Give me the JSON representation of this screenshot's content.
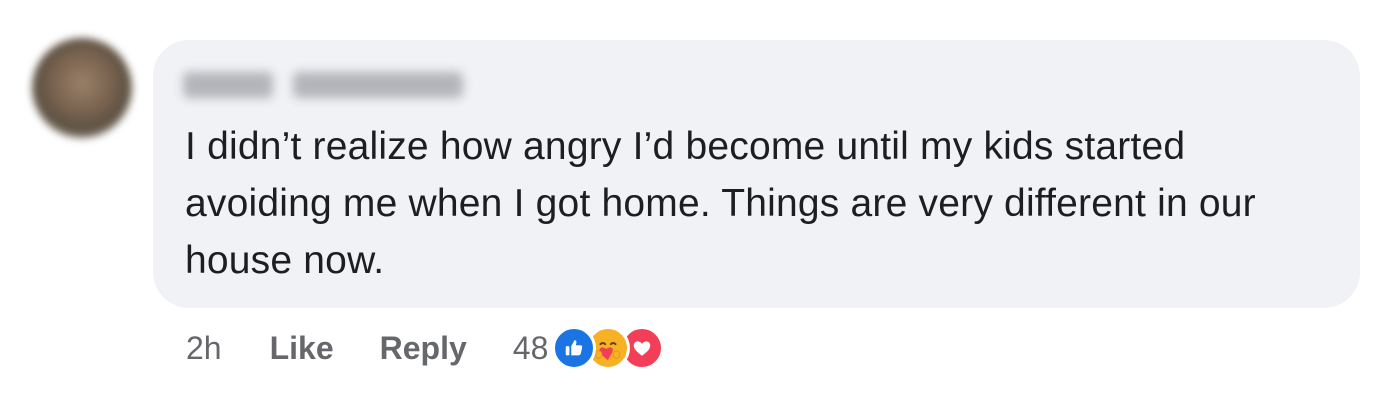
{
  "comment": {
    "author_name": "",
    "text": "I didn’t realize how angry I’d become until my kids started avoiding me when I got home. Things are very different in our house now.",
    "timestamp": "2h",
    "like_label": "Like",
    "reply_label": "Reply",
    "reaction_count": "48",
    "reactions": [
      "like",
      "care",
      "love"
    ]
  },
  "colors": {
    "bubble_bg": "#f0f2f5",
    "text": "#1c1e21",
    "secondary_text": "#65676b",
    "like_blue": "#1b74e4",
    "care_yellow": "#f7b125",
    "love_red": "#f33e58"
  }
}
